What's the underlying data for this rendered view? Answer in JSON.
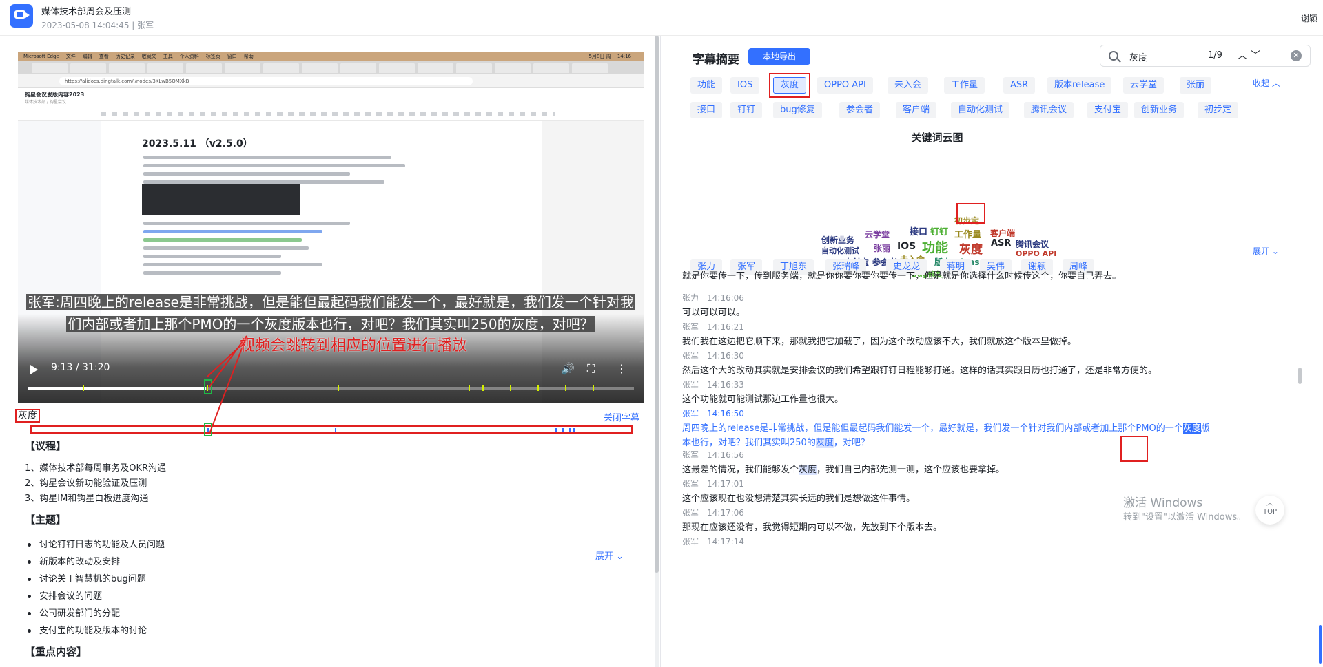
{
  "header": {
    "title": "媒体技术部周会及压测",
    "meta": "2023-05-08 14:04:45 | 张军",
    "user": "谢颖"
  },
  "video": {
    "mac_menu": [
      "Microsoft Edge",
      "文件",
      "编辑",
      "查看",
      "历史记录",
      "收藏夹",
      "工具",
      "个人资料",
      "标签页",
      "窗口",
      "帮助"
    ],
    "mac_time": "5月8日 周一 14:16",
    "url": "https://alidocs.dingtalk.com/i/nodes/3KLwB5QMXkB",
    "doc_title": "钩星会议发版内容2023",
    "doc_subtitle": "媒体技术部 / 钩星会议",
    "doc_heading": "2023.5.11 （v2.5.0）",
    "subtitle_line1": "张军:周四晚上的release是非常挑战，但是能但最起码我们能发一个，最好就是，我们发一个针对我",
    "subtitle_line2": "们内部或者加上那个PMO的一个灰度版本也行，对吧？我们其实叫250的灰度，对吧？",
    "time": "9:13 / 31:20",
    "progress": 0.294,
    "annotation": "视频会跳转到相应的位置进行播放"
  },
  "search_tag": "灰度",
  "close_subtitles": "关闭字幕",
  "agenda": {
    "title": "【议程】",
    "items": [
      "1、媒体技术部每周事务及OKR沟通",
      "2、钩星会议新功能验证及压测",
      "3、钩星IM和钩星白板进度沟通"
    ]
  },
  "topics": {
    "title": "【主题】",
    "expand": "展开",
    "items": [
      "讨论钉钉日志的功能及人员问题",
      "新版本的改动及安排",
      "讨论关于智慧机的bug问题",
      "安排会议的问题",
      "公司研发部门的分配",
      "支付宝的功能及版本的讨论"
    ]
  },
  "key_points": {
    "title": "【重点内容】"
  },
  "summary": {
    "title": "字幕摘要",
    "export": "本地导出",
    "search_value": "灰度",
    "search_count": "1/9",
    "collapse": "收起",
    "keywords_row1": [
      "功能",
      "IOS",
      "灰度",
      "OPPO API",
      "未入会",
      "工作量",
      "ASR",
      "版本release",
      "云学堂",
      "张丽"
    ],
    "keywords_row2": [
      "接口",
      "钉钉",
      "bug修复",
      "参会者",
      "客户端",
      "自动化测试",
      "腾讯会议",
      "支付宝",
      "创新业务",
      "初步定"
    ],
    "cloud_title": "关键词云图",
    "cloud_words": [
      "初步定",
      "云学堂",
      "接口",
      "钉钉",
      "工作量",
      "客户端",
      "创新业务",
      "功能",
      "灰度",
      "ASR",
      "腾讯会议",
      "自动化测试",
      "张丽",
      "IOS",
      "OPPO API",
      "支付宝",
      "参会者",
      "未入会",
      "版本release",
      "bug修复"
    ],
    "cloud_colors": {
      "purple": "#7b3fa0",
      "green": "#4caf32",
      "navy": "#2c3a80",
      "red": "#c0392b",
      "olive": "#9a8a20",
      "teal": "#2a8a6a",
      "dark": "#1f2329"
    },
    "speakers": [
      "张力",
      "张军",
      "丁旭东",
      "张瑞峰",
      "史龙龙",
      "蒋明",
      "吴伟",
      "谢颖",
      "周峰"
    ],
    "expand": "展开"
  },
  "transcript": [
    {
      "speaker": "",
      "time": "",
      "text": "就是你要传一下，传到服务端，就是你你要你要你要传一下，但是就是你选择什么时候传这个，你要自己弄去。"
    },
    {
      "speaker": "张力",
      "time": "14:16:06",
      "text": "可以可以可以。"
    },
    {
      "speaker": "张军",
      "time": "14:16:21",
      "text": "我们我在这边把它顺下来，那就我把它加载了，因为这个改动应该不大，我们就放这个版本里做掉。"
    },
    {
      "speaker": "张军",
      "time": "14:16:30",
      "text": "然后这个大的改动其实就是安排会议的我们希望跟钉钉日程能够打通。这样的话其实跟日历也打通了，还是非常方便的。"
    },
    {
      "speaker": "张军",
      "time": "14:16:33",
      "text": "这个功能就可能测试那边工作量也很大。"
    },
    {
      "speaker": "张军",
      "time": "14:16:50",
      "text_a": "周四晚上的release是非常挑战，但是能但最起码我们能发一个，最好就是，我们发一个针对我们内部或者加上那个PMO的一个",
      "kw1": "灰度",
      "text_b": "版",
      "text_c": "本也行，对吧？我们其实叫250的",
      "kw2": "灰度",
      "text_d": "，对吧？"
    },
    {
      "speaker": "张军",
      "time": "14:16:56",
      "text_a": "这最差的情况，我们能够发个",
      "kw1": "灰度",
      "text_b": "，我们自己内部先测一测，这个应该也要拿掉。"
    },
    {
      "speaker": "张军",
      "time": "14:17:01",
      "text": "这个应该现在也没想清楚其实长远的我们是想做这件事情。"
    },
    {
      "speaker": "张军",
      "time": "14:17:06",
      "text": "那现在应该还没有，我觉得短期内可以不做，先放到下个版本去。"
    },
    {
      "speaker": "张军",
      "time": "14:17:14",
      "text": ""
    }
  ],
  "watermark": {
    "line1": "激活 Windows",
    "line2": "转到\"设置\"以激活 Windows。"
  },
  "top_button": "TOP"
}
